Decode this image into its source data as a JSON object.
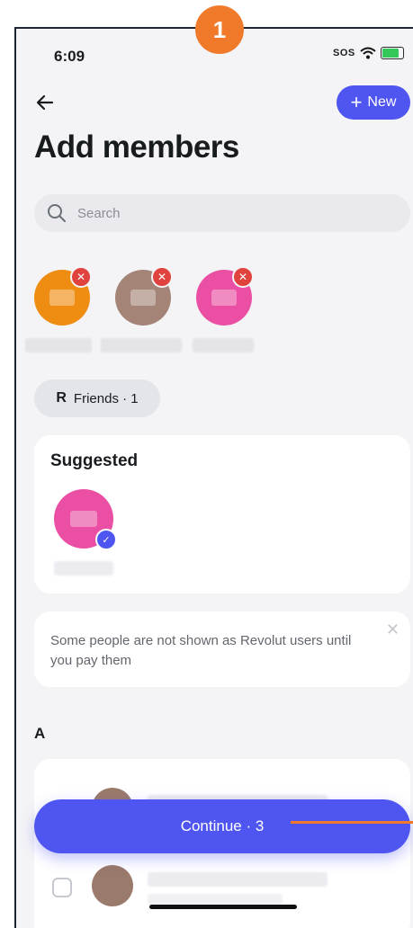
{
  "annotation": {
    "step_number": "1",
    "accent": "#f07a2a"
  },
  "status_bar": {
    "time": "6:09",
    "sos": "SOS"
  },
  "header": {
    "new_button_label": "New",
    "title": "Add members"
  },
  "search": {
    "placeholder": "Search"
  },
  "selected_members": [
    {
      "color": "#ef8c12"
    },
    {
      "color": "#a38476"
    },
    {
      "color": "#ea4fa3"
    }
  ],
  "filter_chip": {
    "label": "Friends · 1"
  },
  "suggested": {
    "heading": "Suggested",
    "avatar_color": "#ea4fa3"
  },
  "info": {
    "text": "Some people are not shown as Revolut users until you pay them"
  },
  "section_letter": "A",
  "list": {
    "rows": [
      {
        "checked": true
      },
      {
        "checked": false
      }
    ]
  },
  "continue_button": {
    "label": "Continue · 3"
  },
  "colors": {
    "primary": "#4f55f1",
    "background": "#f4f4f6",
    "remove": "#e0423d"
  }
}
